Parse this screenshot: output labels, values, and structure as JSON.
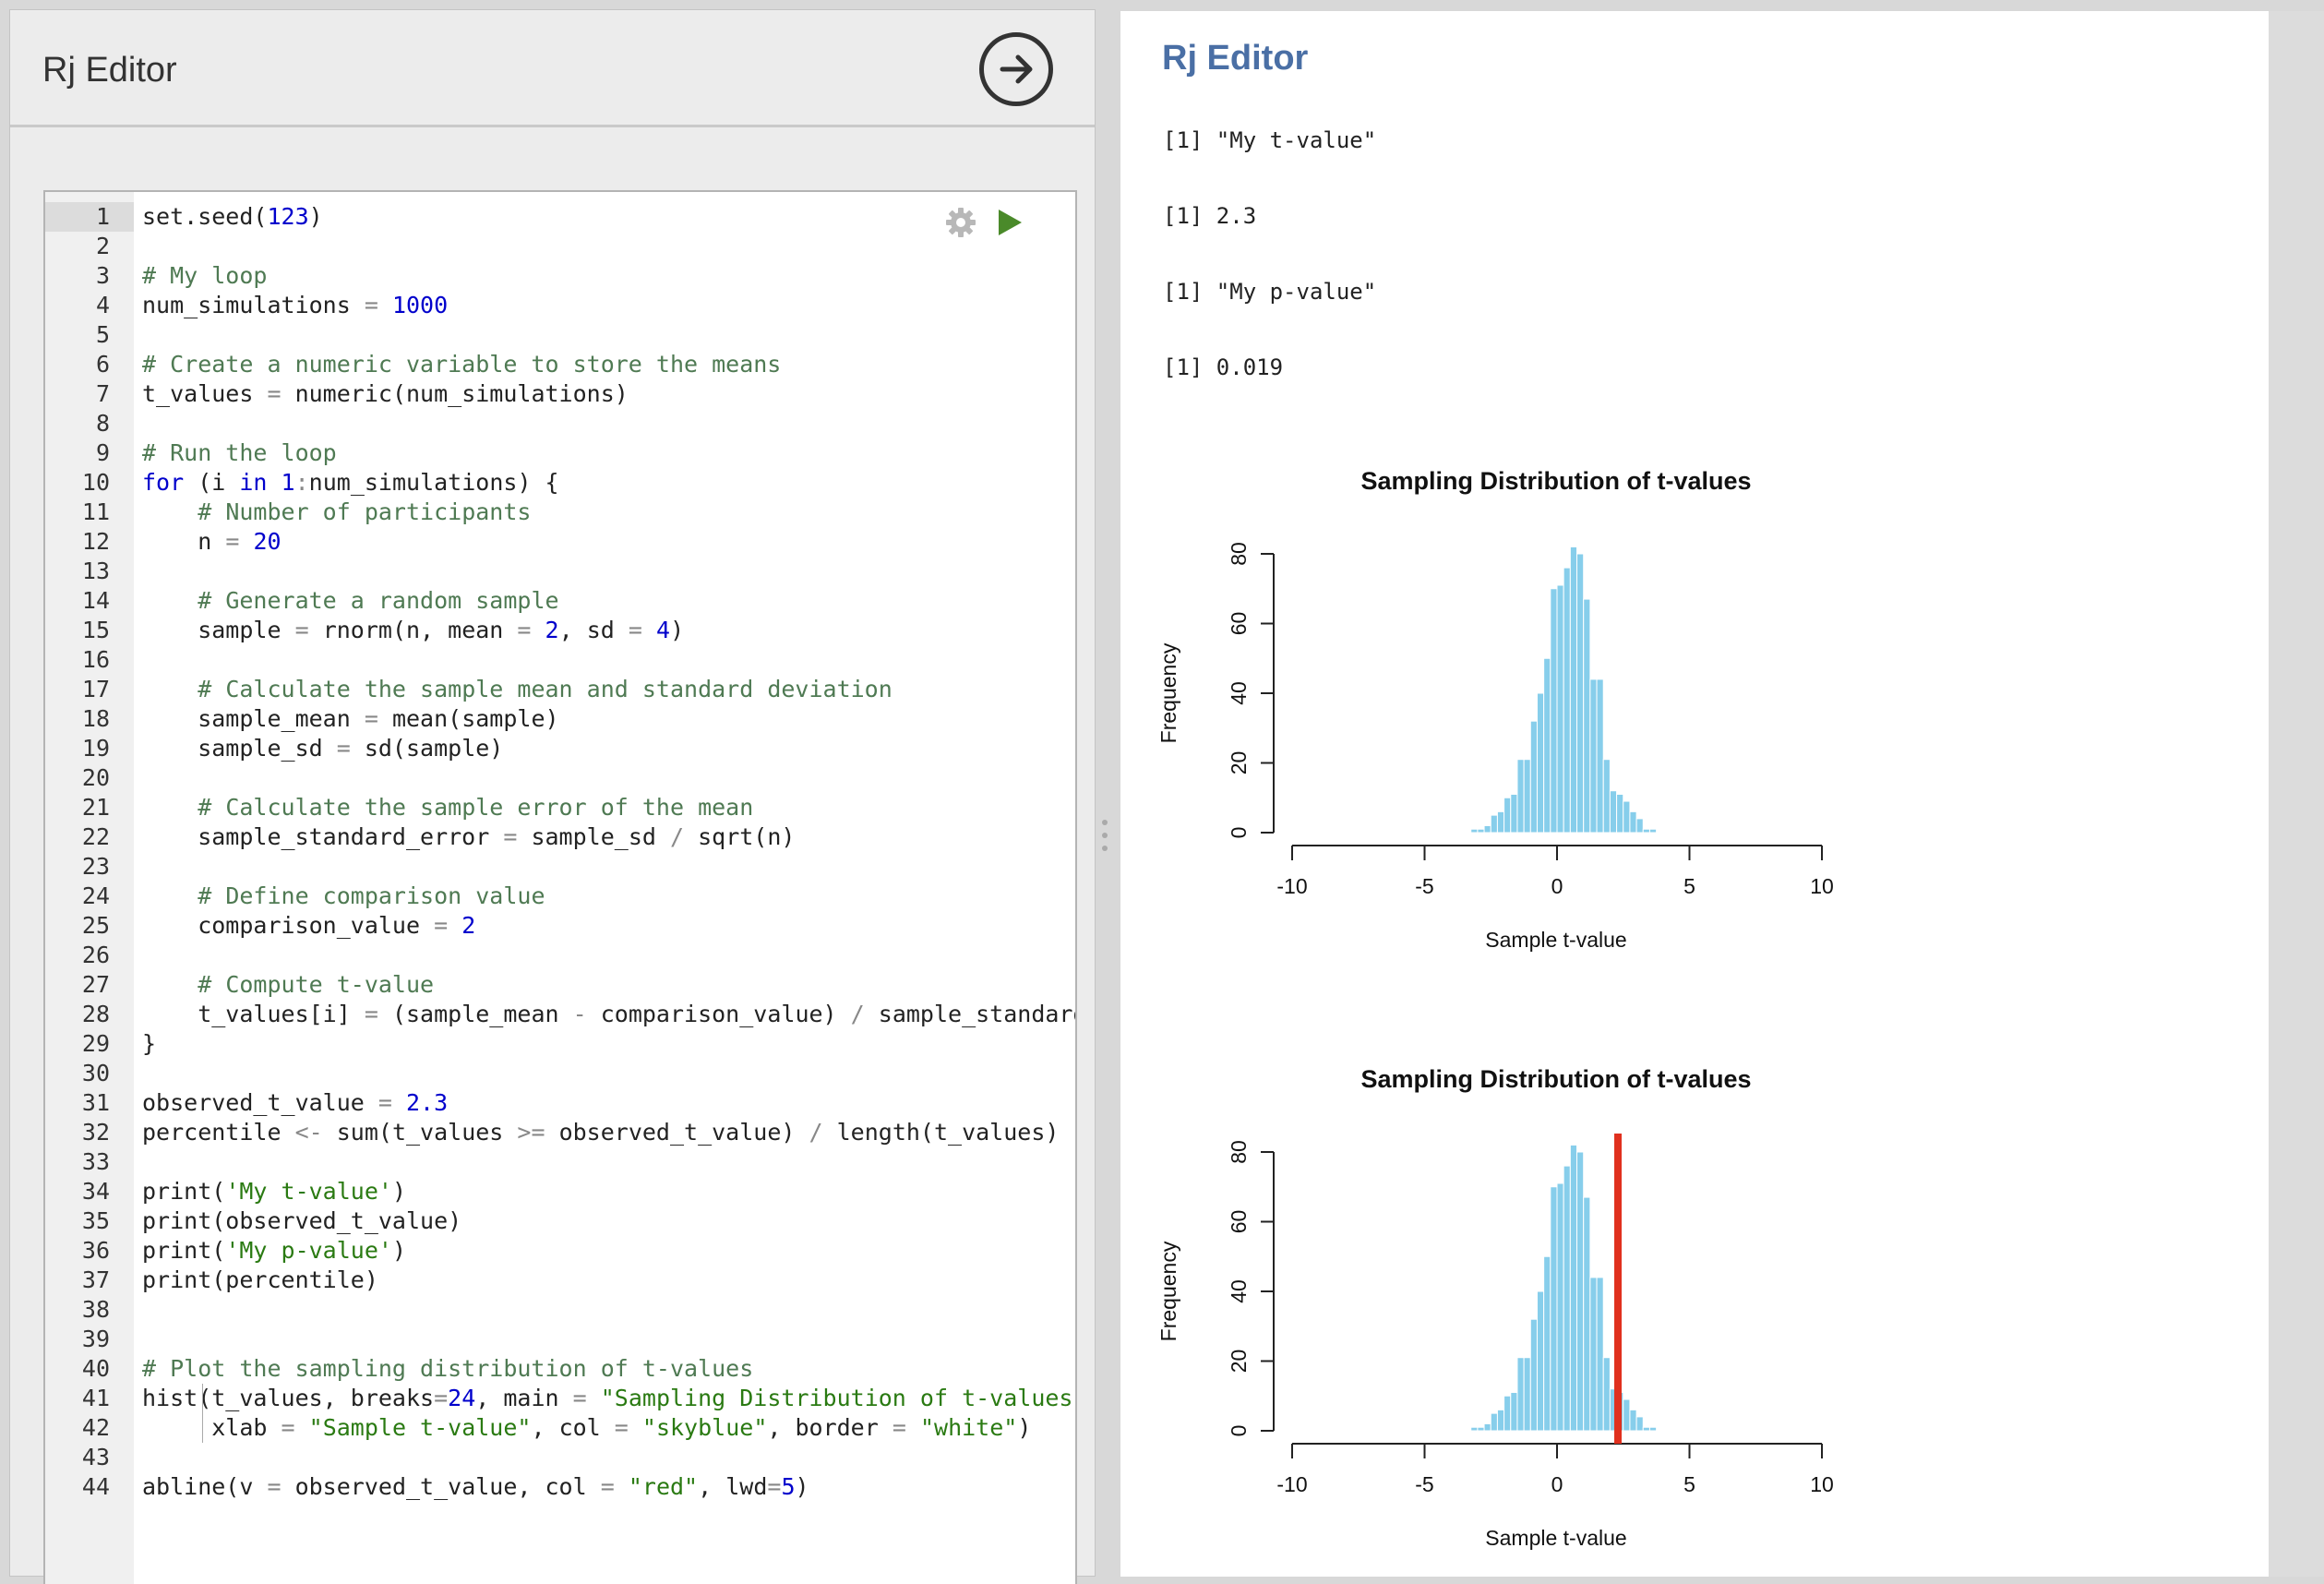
{
  "left": {
    "title": "Rj Editor",
    "run_icon": "arrow-right-circle-icon"
  },
  "editor": {
    "gear_icon": "gear-icon",
    "play_icon": "play-icon",
    "lines": [
      {
        "n": "1",
        "t": [
          [
            "set.seed(",
            ""
          ],
          [
            "123",
            "n"
          ],
          [
            ")",
            ""
          ]
        ]
      },
      {
        "n": "2",
        "t": []
      },
      {
        "n": "3",
        "t": [
          [
            "# My loop",
            "c"
          ]
        ]
      },
      {
        "n": "4",
        "t": [
          [
            "num_simulations ",
            ""
          ],
          [
            "=",
            "o"
          ],
          [
            " ",
            ""
          ],
          [
            "1000",
            "n"
          ]
        ]
      },
      {
        "n": "5",
        "t": []
      },
      {
        "n": "6",
        "t": [
          [
            "# Create a numeric variable to store the means",
            "c"
          ]
        ]
      },
      {
        "n": "7",
        "t": [
          [
            "t_values ",
            ""
          ],
          [
            "=",
            "o"
          ],
          [
            " numeric(num_simulations)",
            ""
          ]
        ]
      },
      {
        "n": "8",
        "t": []
      },
      {
        "n": "9",
        "t": [
          [
            "# Run the loop",
            "c"
          ]
        ]
      },
      {
        "n": "10",
        "t": [
          [
            "for",
            "k"
          ],
          [
            " (i ",
            ""
          ],
          [
            "in",
            "k"
          ],
          [
            " ",
            ""
          ],
          [
            "1",
            "n"
          ],
          [
            ":",
            "o"
          ],
          [
            "num_simulations) {",
            ""
          ]
        ]
      },
      {
        "n": "11",
        "t": [
          [
            "    ",
            ""
          ],
          [
            "# Number of participants",
            "c"
          ]
        ]
      },
      {
        "n": "12",
        "t": [
          [
            "    n ",
            ""
          ],
          [
            "=",
            "o"
          ],
          [
            " ",
            ""
          ],
          [
            "20",
            "n"
          ]
        ]
      },
      {
        "n": "13",
        "t": []
      },
      {
        "n": "14",
        "t": [
          [
            "    ",
            ""
          ],
          [
            "# Generate a random sample",
            "c"
          ]
        ]
      },
      {
        "n": "15",
        "t": [
          [
            "    sample ",
            ""
          ],
          [
            "=",
            "o"
          ],
          [
            " rnorm(n, mean ",
            ""
          ],
          [
            "=",
            "o"
          ],
          [
            " ",
            ""
          ],
          [
            "2",
            "n"
          ],
          [
            ", sd ",
            ""
          ],
          [
            "=",
            "o"
          ],
          [
            " ",
            ""
          ],
          [
            "4",
            "n"
          ],
          [
            ")",
            ""
          ]
        ]
      },
      {
        "n": "16",
        "t": []
      },
      {
        "n": "17",
        "t": [
          [
            "    ",
            ""
          ],
          [
            "# Calculate the sample mean and standard deviation",
            "c"
          ]
        ]
      },
      {
        "n": "18",
        "t": [
          [
            "    sample_mean ",
            ""
          ],
          [
            "=",
            "o"
          ],
          [
            " mean(sample)",
            ""
          ]
        ]
      },
      {
        "n": "19",
        "t": [
          [
            "    sample_sd ",
            ""
          ],
          [
            "=",
            "o"
          ],
          [
            " sd(sample)",
            ""
          ]
        ]
      },
      {
        "n": "20",
        "t": []
      },
      {
        "n": "21",
        "t": [
          [
            "    ",
            ""
          ],
          [
            "# Calculate the sample error of the mean",
            "c"
          ]
        ]
      },
      {
        "n": "22",
        "t": [
          [
            "    sample_standard_error ",
            ""
          ],
          [
            "=",
            "o"
          ],
          [
            " sample_sd ",
            ""
          ],
          [
            "/",
            "o"
          ],
          [
            " sqrt(n)",
            ""
          ]
        ]
      },
      {
        "n": "23",
        "t": []
      },
      {
        "n": "24",
        "t": [
          [
            "    ",
            ""
          ],
          [
            "# Define comparison value",
            "c"
          ]
        ]
      },
      {
        "n": "25",
        "t": [
          [
            "    comparison_value ",
            ""
          ],
          [
            "=",
            "o"
          ],
          [
            " ",
            ""
          ],
          [
            "2",
            "n"
          ]
        ]
      },
      {
        "n": "26",
        "t": []
      },
      {
        "n": "27",
        "t": [
          [
            "    ",
            ""
          ],
          [
            "# Compute t-value",
            "c"
          ]
        ]
      },
      {
        "n": "28",
        "t": [
          [
            "    t_values[i] ",
            ""
          ],
          [
            "=",
            "o"
          ],
          [
            " (sample_mean ",
            ""
          ],
          [
            "-",
            "o"
          ],
          [
            " comparison_value) ",
            ""
          ],
          [
            "/",
            "o"
          ],
          [
            " sample_standard_e",
            ""
          ]
        ]
      },
      {
        "n": "29",
        "t": [
          [
            "}",
            ""
          ]
        ]
      },
      {
        "n": "30",
        "t": []
      },
      {
        "n": "31",
        "t": [
          [
            "observed_t_value ",
            ""
          ],
          [
            "=",
            "o"
          ],
          [
            " ",
            ""
          ],
          [
            "2.3",
            "n"
          ]
        ]
      },
      {
        "n": "32",
        "t": [
          [
            "percentile ",
            ""
          ],
          [
            "<-",
            "o"
          ],
          [
            " sum(t_values ",
            ""
          ],
          [
            ">=",
            "o"
          ],
          [
            " observed_t_value) ",
            ""
          ],
          [
            "/",
            "o"
          ],
          [
            " length(t_values)",
            ""
          ]
        ]
      },
      {
        "n": "33",
        "t": []
      },
      {
        "n": "34",
        "t": [
          [
            "print(",
            ""
          ],
          [
            "'My t-value'",
            "s"
          ],
          [
            ")",
            ""
          ]
        ]
      },
      {
        "n": "35",
        "t": [
          [
            "print(observed_t_value)",
            ""
          ]
        ]
      },
      {
        "n": "36",
        "t": [
          [
            "print(",
            ""
          ],
          [
            "'My p-value'",
            "s"
          ],
          [
            ")",
            ""
          ]
        ]
      },
      {
        "n": "37",
        "t": [
          [
            "print(percentile)",
            ""
          ]
        ]
      },
      {
        "n": "38",
        "t": []
      },
      {
        "n": "39",
        "t": []
      },
      {
        "n": "40",
        "t": [
          [
            "# Plot the sampling distribution of t-values",
            "c"
          ]
        ]
      },
      {
        "n": "41",
        "t": [
          [
            "hist(t_values, breaks",
            ""
          ],
          [
            "=",
            "o"
          ],
          [
            "24",
            "n"
          ],
          [
            ", main ",
            ""
          ],
          [
            "=",
            "o"
          ],
          [
            " ",
            ""
          ],
          [
            "\"Sampling Distribution of t-values\"",
            "s"
          ],
          [
            ",",
            ""
          ]
        ]
      },
      {
        "n": "42",
        "t": [
          [
            "     xlab ",
            ""
          ],
          [
            "=",
            "o"
          ],
          [
            " ",
            ""
          ],
          [
            "\"Sample t-value\"",
            "s"
          ],
          [
            ", col ",
            ""
          ],
          [
            "=",
            "o"
          ],
          [
            " ",
            ""
          ],
          [
            "\"skyblue\"",
            "s"
          ],
          [
            ", border ",
            ""
          ],
          [
            "=",
            "o"
          ],
          [
            " ",
            ""
          ],
          [
            "\"white\"",
            "s"
          ],
          [
            ")",
            ""
          ]
        ]
      },
      {
        "n": "43",
        "t": []
      },
      {
        "n": "44",
        "t": [
          [
            "abline(v ",
            ""
          ],
          [
            "=",
            "o"
          ],
          [
            " observed_t_value, col ",
            ""
          ],
          [
            "=",
            "o"
          ],
          [
            " ",
            ""
          ],
          [
            "\"red\"",
            "s"
          ],
          [
            ", lwd",
            ""
          ],
          [
            "=",
            "o"
          ],
          [
            "5",
            "n"
          ],
          [
            ")",
            ""
          ]
        ]
      }
    ]
  },
  "right": {
    "title": "Rj Editor",
    "outputs": [
      "[1] \"My t-value\"",
      "[1] 2.3",
      "[1] \"My p-value\"",
      "[1] 0.019"
    ]
  },
  "chart_data": [
    {
      "type": "bar",
      "title": "Sampling Distribution of t-values",
      "xlabel": "Sample t-value",
      "ylabel": "Frequency",
      "xlim": [
        -10,
        10
      ],
      "ylim": [
        0,
        80
      ],
      "xticks": [
        "-10",
        "-5",
        "0",
        "5",
        "10"
      ],
      "yticks": [
        "0",
        "20",
        "40",
        "60",
        "80"
      ],
      "bar_color": "#87ceeb",
      "bin_width": 0.25,
      "bin_start": -3.25,
      "values": [
        1,
        1,
        2,
        5,
        6,
        10,
        11,
        21,
        21,
        32,
        40,
        50,
        70,
        71,
        76,
        82,
        80,
        67,
        44,
        44,
        21,
        12,
        11,
        9,
        6,
        4,
        1,
        1,
        0,
        0,
        0
      ]
    },
    {
      "type": "bar",
      "title": "Sampling Distribution of t-values",
      "xlabel": "Sample t-value",
      "ylabel": "Frequency",
      "xlim": [
        -10,
        10
      ],
      "ylim": [
        0,
        80
      ],
      "xticks": [
        "-10",
        "-5",
        "0",
        "5",
        "10"
      ],
      "yticks": [
        "0",
        "20",
        "40",
        "60",
        "80"
      ],
      "bar_color": "#87ceeb",
      "bin_width": 0.25,
      "bin_start": -3.25,
      "values": [
        1,
        1,
        2,
        5,
        6,
        10,
        11,
        21,
        21,
        32,
        40,
        50,
        70,
        71,
        76,
        82,
        80,
        67,
        44,
        44,
        21,
        12,
        11,
        9,
        6,
        4,
        1,
        1,
        0,
        0,
        0
      ],
      "vline": {
        "x": 2.3,
        "color": "#e0301e"
      }
    }
  ]
}
